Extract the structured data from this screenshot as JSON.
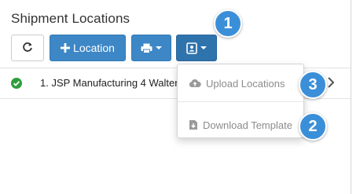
{
  "panel": {
    "title": "Shipment Locations"
  },
  "toolbar": {
    "refresh_icon": "refresh-icon",
    "add_location_label": "Location",
    "add_icon": "plus-icon",
    "print_icon": "printer-icon",
    "contact_icon": "address-card-icon"
  },
  "locations": [
    {
      "status_icon": "check-circle-icon",
      "label": "1. JSP Manufacturing 4 Walter",
      "status_color": "#2e9e3c"
    }
  ],
  "dropdown": {
    "items": [
      {
        "label": "Upload Locations",
        "icon": "cloud-upload-icon"
      },
      {
        "label": "Download Template",
        "icon": "file-download-icon"
      }
    ]
  },
  "callouts": [
    "1",
    "3",
    "2"
  ],
  "colors": {
    "primary": "#3d87c6",
    "badge": "#3b8fd8",
    "success": "#2e9e3c"
  }
}
